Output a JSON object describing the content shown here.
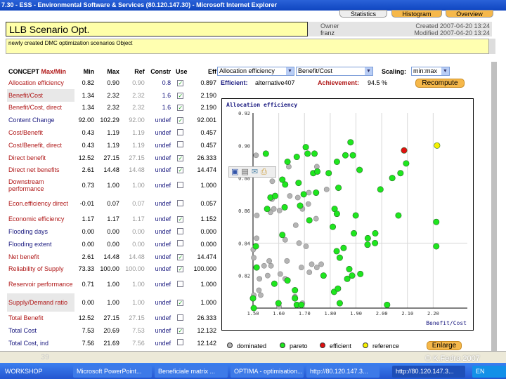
{
  "window": {
    "title": "7.30 - ESS - Environmental Software & Services (80.120.147.30) - Microsoft Internet Explorer"
  },
  "toolbar": {
    "statistics": "Statistics",
    "histogram": "Histogram",
    "overview": "Overview"
  },
  "header": {
    "title": "LLB Scenario Opt.",
    "owner_label": "Owner",
    "owner": "franz",
    "created": "Created 2007-04-20 13:24",
    "modified": "Modified 2007-04-20 13:24",
    "description": "newly created DMC optimization scenarios Object"
  },
  "table": {
    "headers": {
      "concept": "CONCEPT",
      "maxmin": "Max/Min",
      "min": "Min",
      "max": "Max",
      "ref": "Ref",
      "constr": "Constr",
      "use": "Use",
      "eff": "Eff"
    },
    "rows": [
      {
        "name": "Allocation efficiency",
        "color": "red",
        "min": "0.82",
        "max": "0.90",
        "ref": "0.90",
        "constr": "0.8",
        "use": true,
        "eff": "0.897"
      },
      {
        "name": "Benefit/Cost",
        "color": "red",
        "hl": true,
        "min": "1.34",
        "max": "2.32",
        "ref": "2.32",
        "constr": "1.6",
        "use": true,
        "eff": "2.190"
      },
      {
        "name": "Benefit/Cost, direct",
        "color": "red",
        "min": "1.34",
        "max": "2.32",
        "ref": "2.32",
        "constr": "1.6",
        "use": true,
        "eff": "2.190"
      },
      {
        "name": "Content Change",
        "color": "blue",
        "min": "92.00",
        "max": "102.29",
        "ref": "92.00",
        "constr": "undef",
        "use": true,
        "eff": "92.001"
      },
      {
        "name": "Cost/Benefit",
        "color": "red",
        "min": "0.43",
        "max": "1.19",
        "ref": "1.19",
        "constr": "undef",
        "use": false,
        "eff": "0.457"
      },
      {
        "name": "Cost/Benefit, direct",
        "color": "red",
        "min": "0.43",
        "max": "1.19",
        "ref": "1.19",
        "constr": "undef",
        "use": false,
        "eff": "0.457"
      },
      {
        "name": "Direct benefit",
        "color": "red",
        "min": "12.52",
        "max": "27.15",
        "ref": "27.15",
        "constr": "undef",
        "use": true,
        "eff": "26.333"
      },
      {
        "name": "Direct net benefits",
        "color": "red",
        "min": "2.61",
        "max": "14.48",
        "ref": "14.48",
        "constr": "undef",
        "use": true,
        "eff": "14.474"
      },
      {
        "name": "Downstream performance",
        "color": "red",
        "tall": true,
        "min": "0.73",
        "max": "1.00",
        "ref": "1.00",
        "constr": "undef",
        "use": false,
        "eff": "1.000"
      },
      {
        "name": "Econ.efficiency direct",
        "color": "red",
        "tall": true,
        "min": "-0.01",
        "max": "0.07",
        "ref": "0.07",
        "constr": "undef",
        "use": false,
        "eff": "0.057"
      },
      {
        "name": "Economic efficiency",
        "color": "red",
        "min": "1.17",
        "max": "1.17",
        "ref": "1.17",
        "constr": "undef",
        "use": true,
        "eff": "1.152"
      },
      {
        "name": "Flooding days",
        "color": "blue",
        "min": "0.00",
        "max": "0.00",
        "ref": "0.00",
        "constr": "undef",
        "use": false,
        "eff": "0.000"
      },
      {
        "name": "Flooding extent",
        "color": "blue",
        "min": "0.00",
        "max": "0.00",
        "ref": "0.00",
        "constr": "undef",
        "use": false,
        "eff": "0.000"
      },
      {
        "name": "Net benefit",
        "color": "red",
        "min": "2.61",
        "max": "14.48",
        "ref": "14.48",
        "constr": "undef",
        "use": true,
        "eff": "14.474"
      },
      {
        "name": "Reliability of Supply",
        "color": "red",
        "min": "73.33",
        "max": "100.00",
        "ref": "100.00",
        "constr": "undef",
        "use": true,
        "eff": "100.000"
      },
      {
        "name": "Reservoir performance",
        "color": "red",
        "tall": true,
        "min": "0.71",
        "max": "1.00",
        "ref": "1.00",
        "constr": "undef",
        "use": false,
        "eff": "1.000"
      },
      {
        "name": "Supply/Demand ratio",
        "color": "red",
        "tall": true,
        "hl": true,
        "min": "0.00",
        "max": "1.00",
        "ref": "1.00",
        "constr": "undef",
        "use": true,
        "eff": "1.000"
      },
      {
        "name": "Total Benefit",
        "color": "red",
        "min": "12.52",
        "max": "27.15",
        "ref": "27.15",
        "constr": "undef",
        "use": false,
        "eff": "26.333"
      },
      {
        "name": "Total Cost",
        "color": "blue",
        "min": "7.53",
        "max": "20.69",
        "ref": "7.53",
        "constr": "undef",
        "use": true,
        "eff": "12.132"
      },
      {
        "name": "Total Cost, ind",
        "color": "blue",
        "min": "7.56",
        "max": "21.69",
        "ref": "7.56",
        "constr": "undef",
        "use": false,
        "eff": "12.142"
      }
    ]
  },
  "controls": {
    "y_select": "Allocation efficiency",
    "x_select": "Benefit/Cost",
    "scaling_label": "Scaling:",
    "scaling": "min:max",
    "efficient_label": "Efficient:",
    "efficient": "alternative407",
    "achievement_label": "Achievement:",
    "achievement": "94.5 %",
    "recompute": "Recompute",
    "enlarge": "Enlarge"
  },
  "legend": {
    "dominated": "dominated",
    "pareto": "pareto",
    "efficient": "efficient",
    "reference": "reference"
  },
  "colors": {
    "dominated": "#b4b4b4",
    "pareto": "#1ee61e",
    "efficient": "#e01010",
    "reference": "#f5f000"
  },
  "chart_data": {
    "type": "scatter",
    "title": "Allocation efficiency",
    "xlabel": "Benefit/Cost",
    "ylabel": "Allocation efficiency",
    "xlim": [
      1.5,
      2.3
    ],
    "ylim": [
      0.8,
      0.92
    ],
    "xticks": [
      "1.50",
      "1.60",
      "1.70",
      "1.80",
      "1.90",
      "2.00",
      "2.10",
      "2.20"
    ],
    "yticks": [
      "0.92",
      "0.90",
      "0.88",
      "0.86",
      "0.84",
      "0.82"
    ],
    "series": [
      {
        "name": "pareto",
        "points": [
          [
            1.55,
            0.895
          ],
          [
            1.705,
            0.899
          ],
          [
            1.712,
            0.895
          ],
          [
            1.739,
            0.895
          ],
          [
            1.67,
            0.893
          ],
          [
            1.634,
            0.89
          ],
          [
            1.879,
            0.902
          ],
          [
            1.859,
            0.894
          ],
          [
            1.888,
            0.894
          ],
          [
            1.826,
            0.89
          ],
          [
            1.734,
            0.883
          ],
          [
            1.75,
            0.884
          ],
          [
            1.794,
            0.883
          ],
          [
            1.914,
            0.885
          ],
          [
            1.614,
            0.879
          ],
          [
            1.625,
            0.876
          ],
          [
            1.677,
            0.877
          ],
          [
            1.832,
            0.874
          ],
          [
            1.568,
            0.868
          ],
          [
            1.586,
            0.869
          ],
          [
            1.697,
            0.87
          ],
          [
            1.745,
            0.871
          ],
          [
            1.995,
            0.873
          ],
          [
            2.041,
            0.88
          ],
          [
            2.073,
            0.883
          ],
          [
            2.095,
            0.889
          ],
          [
            1.555,
            0.861
          ],
          [
            1.623,
            0.862
          ],
          [
            1.683,
            0.863
          ],
          [
            1.817,
            0.861
          ],
          [
            1.826,
            0.858
          ],
          [
            1.899,
            0.857
          ],
          [
            1.719,
            0.854
          ],
          [
            1.81,
            0.85
          ],
          [
            1.614,
            0.845
          ],
          [
            1.892,
            0.846
          ],
          [
            1.946,
            0.843
          ],
          [
            1.975,
            0.846
          ],
          [
            1.945,
            0.839
          ],
          [
            1.974,
            0.84
          ],
          [
            1.511,
            0.838
          ],
          [
            1.825,
            0.835
          ],
          [
            1.852,
            0.837
          ],
          [
            1.837,
            0.831
          ],
          [
            1.514,
            0.825
          ],
          [
            1.874,
            0.824
          ],
          [
            1.774,
            0.82
          ],
          [
            1.885,
            0.82
          ],
          [
            1.917,
            0.821
          ],
          [
            1.866,
            0.818
          ],
          [
            1.634,
            0.817
          ],
          [
            1.583,
            0.815
          ],
          [
            1.663,
            0.811
          ],
          [
            1.815,
            0.81
          ],
          [
            1.83,
            0.812
          ],
          [
            1.5,
            0.806
          ],
          [
            1.663,
            0.806
          ],
          [
            1.503,
            0.8
          ],
          [
            1.599,
            0.803
          ],
          [
            1.67,
            0.802
          ],
          [
            1.688,
            0.802
          ],
          [
            1.837,
            0.803
          ],
          [
            2.021,
            0.802
          ],
          [
            2.212,
            0.853
          ],
          [
            2.212,
            0.838
          ],
          [
            2.065,
            0.857
          ]
        ]
      },
      {
        "name": "dominated",
        "points": [
          [
            1.512,
            0.894
          ],
          [
            1.639,
            0.887
          ],
          [
            1.748,
            0.887
          ],
          [
            1.575,
            0.878
          ],
          [
            1.786,
            0.873
          ],
          [
            1.643,
            0.869
          ],
          [
            1.674,
            0.868
          ],
          [
            1.717,
            0.871
          ],
          [
            1.715,
            0.864
          ],
          [
            1.574,
            0.867
          ],
          [
            1.568,
            0.859
          ],
          [
            1.581,
            0.861
          ],
          [
            1.603,
            0.86
          ],
          [
            1.692,
            0.861
          ],
          [
            1.515,
            0.857
          ],
          [
            1.745,
            0.855
          ],
          [
            1.666,
            0.851
          ],
          [
            1.514,
            0.843
          ],
          [
            1.625,
            0.842
          ],
          [
            1.679,
            0.84
          ],
          [
            1.706,
            0.838
          ],
          [
            1.501,
            0.836
          ],
          [
            1.503,
            0.831
          ],
          [
            1.563,
            0.829
          ],
          [
            1.632,
            0.829
          ],
          [
            1.543,
            0.826
          ],
          [
            1.57,
            0.826
          ],
          [
            1.688,
            0.825
          ],
          [
            1.728,
            0.827
          ],
          [
            1.748,
            0.825
          ],
          [
            1.765,
            0.827
          ],
          [
            1.719,
            0.822
          ],
          [
            1.606,
            0.821
          ],
          [
            1.557,
            0.82
          ],
          [
            1.525,
            0.818
          ],
          [
            1.625,
            0.818
          ],
          [
            1.523,
            0.811
          ],
          [
            1.53,
            0.808
          ],
          [
            1.503,
            0.808
          ],
          [
            1.663,
            0.807
          ],
          [
            1.692,
            0.803
          ],
          [
            1.601,
            0.801
          ]
        ]
      },
      {
        "name": "efficient",
        "points": [
          [
            2.087,
            0.897
          ]
        ]
      },
      {
        "name": "reference",
        "points": [
          [
            2.215,
            0.9
          ]
        ]
      }
    ]
  },
  "slide": {
    "number": "39",
    "copyright": "© K.Fedra 2007"
  },
  "taskbar": {
    "items": [
      "WORKSHOP",
      "Microsoft PowerPoint...",
      "Beneficiale matrix ...",
      "OPTIMA - optimisation...",
      "http://80.120.147.3...",
      "http://80.120.147.3..."
    ],
    "lang": "EN"
  }
}
